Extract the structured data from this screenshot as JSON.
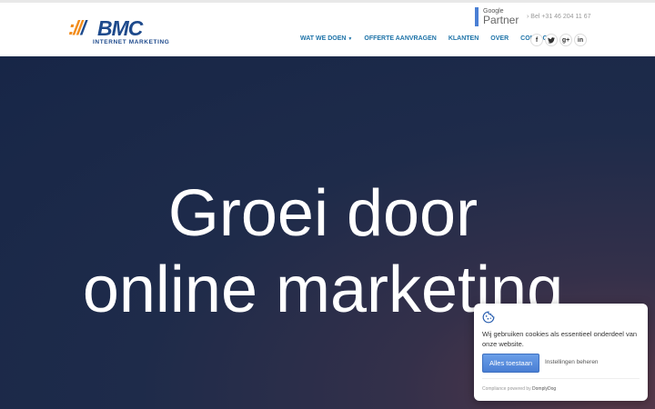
{
  "logo": {
    "slashes_orange": "://",
    "slash_blue": "/",
    "name": "BMC",
    "sub": "INTERNET MARKETING"
  },
  "google_partner": {
    "google": "Google",
    "partner": "Partner"
  },
  "phone": "› Bel +31 46 204 11 67",
  "nav": [
    {
      "label": "WAT WE DOEN",
      "has_caret": true
    },
    {
      "label": "OFFERTE AANVRAGEN"
    },
    {
      "label": "KLANTEN"
    },
    {
      "label": "OVER"
    },
    {
      "label": "CONTACT"
    }
  ],
  "social": [
    {
      "icon": "facebook-icon",
      "glyph": "f"
    },
    {
      "icon": "twitter-icon",
      "glyph": "🐦"
    },
    {
      "icon": "google-plus-icon",
      "glyph": "g+"
    },
    {
      "icon": "linkedin-icon",
      "glyph": "in"
    }
  ],
  "hero": {
    "line1": "Groei door",
    "line2": "online marketing"
  },
  "cookie": {
    "text": "Wij gebruiken cookies als essentieel onderdeel van onze website.",
    "allow_button": "Alles toestaan",
    "settings_link": "Instellingen beheren",
    "footer_prefix": "Compliance powered by ",
    "footer_brand": "DomplyDog"
  },
  "colors": {
    "brand_blue": "#1e4a8c",
    "brand_orange": "#f28c1c",
    "nav_blue": "#1e73a8",
    "hero_bg": "#172647"
  }
}
